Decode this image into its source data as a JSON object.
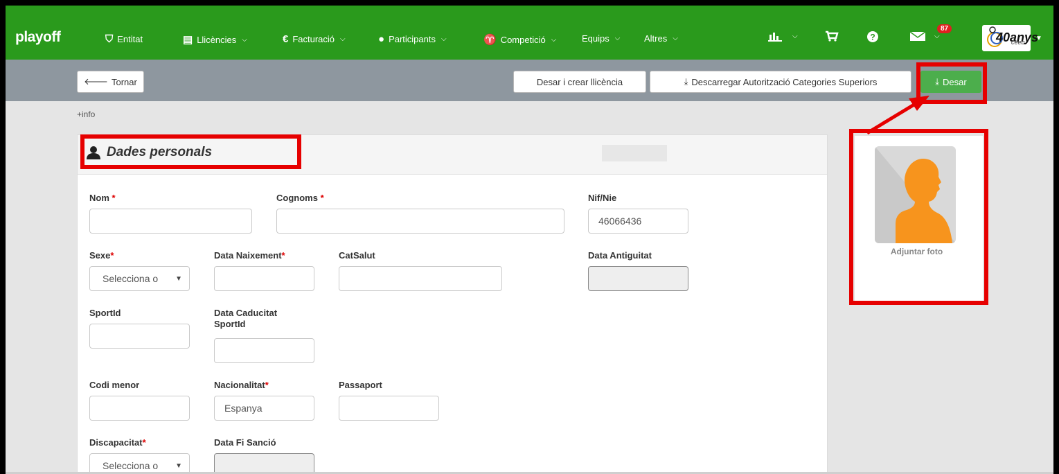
{
  "navbar": {
    "brand": "playoff",
    "items": [
      {
        "label": "Entitat",
        "icon": "shield-icon",
        "dropdown": false
      },
      {
        "label": "Llicències",
        "icon": "id-card-icon",
        "dropdown": true
      },
      {
        "label": "Facturació",
        "icon": "euro-icon",
        "dropdown": true
      },
      {
        "label": "Participants",
        "icon": "user-icon",
        "dropdown": true
      },
      {
        "label": "Competició",
        "icon": "trophy-icon",
        "dropdown": true
      },
      {
        "label": "Equips",
        "dropdown": true
      },
      {
        "label": "Altres",
        "dropdown": true
      }
    ],
    "right_icons": [
      "bar-chart-icon",
      "cart-icon",
      "help-icon",
      "mail-icon"
    ],
    "mail_badge": "87",
    "logo_text": "40anys",
    "logo_sub": "ceeb"
  },
  "toolbar": {
    "back_label": "Tornar",
    "save_create_label": "Desar i crear llicència",
    "download_label": "Descarregar Autorització Categories Superiors",
    "save_label": "Desar"
  },
  "info_link": "+info",
  "panel": {
    "title": "Dades personals",
    "fields": {
      "nom": {
        "label": "Nom",
        "value": ""
      },
      "cognoms": {
        "label": "Cognoms",
        "value": ""
      },
      "nif": {
        "label": "Nif/Nie",
        "value": "46066436"
      },
      "sexe": {
        "label": "Sexe",
        "value": "Selecciona o"
      },
      "data_naixement": {
        "label": "Data Naixement",
        "value": ""
      },
      "catsalut": {
        "label": "CatSalut",
        "value": ""
      },
      "data_antiguitat": {
        "label": "Data Antiguitat",
        "value": ""
      },
      "sportid": {
        "label": "SportId",
        "value": ""
      },
      "data_caducitat_1": "Data Caducitat",
      "data_caducitat_2": "SportId",
      "codi_menor": {
        "label": "Codi menor",
        "value": ""
      },
      "nacionalitat": {
        "label": "Nacionalitat",
        "value": "Espanya"
      },
      "passaport": {
        "label": "Passaport",
        "value": ""
      },
      "discapacitat": {
        "label": "Discapacitat",
        "value": "Selecciona o"
      },
      "data_fi_sancio": {
        "label": "Data Fi Sanció",
        "value": ""
      }
    },
    "required_mark": "*"
  },
  "photo": {
    "label": "Adjuntar foto"
  },
  "colors": {
    "navbar": "#2a9a1c",
    "toolbar": "#8e979f",
    "save_button": "#4cae4c",
    "annotation": "#e60000",
    "avatar": "#f7941d"
  }
}
